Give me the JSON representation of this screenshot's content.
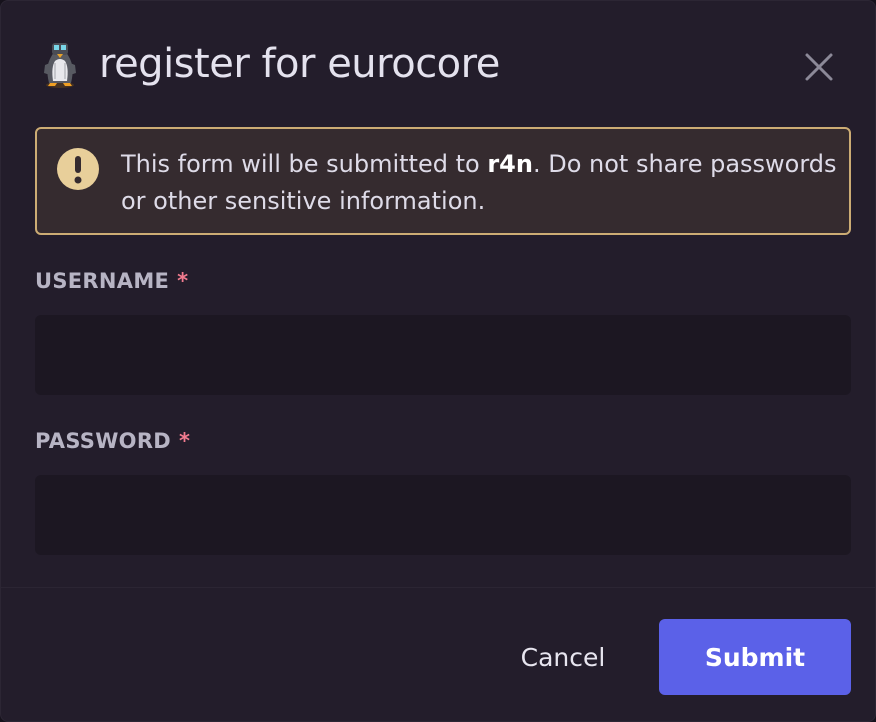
{
  "modal": {
    "title": "register for eurocore",
    "app_icon": "penguin-icon",
    "close_icon": "close-icon"
  },
  "warning": {
    "icon": "exclamation-icon",
    "text_before": "This form will be submitted to ",
    "app_name": "r4n",
    "text_after": ". Do not share passwords or other sensitive information."
  },
  "fields": [
    {
      "label": "USERNAME",
      "required_mark": "*",
      "value": "",
      "placeholder": ""
    },
    {
      "label": "PASSWORD",
      "required_mark": "*",
      "value": "",
      "placeholder": ""
    }
  ],
  "footer": {
    "cancel_label": "Cancel",
    "submit_label": "Submit"
  },
  "colors": {
    "background": "#231d2b",
    "warning_border": "#ccac74",
    "warning_background": "#352b2f",
    "required": "#f27b8f",
    "submit": "#5b61e8"
  }
}
